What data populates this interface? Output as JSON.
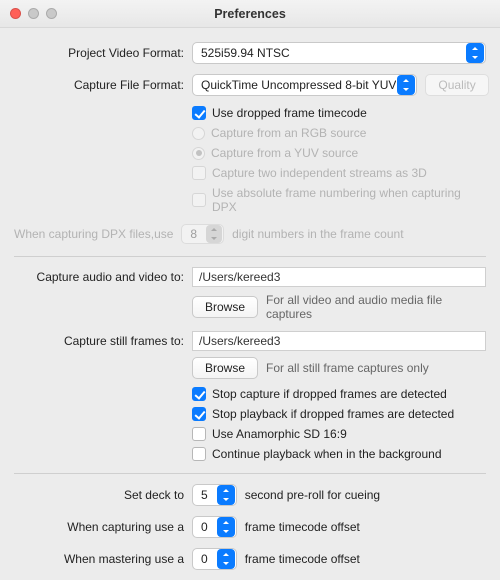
{
  "title": "Preferences",
  "format": {
    "video_label": "Project Video Format:",
    "video_value": "525i59.94 NTSC",
    "file_label": "Capture File Format:",
    "file_value": "QuickTime Uncompressed 8-bit YUV",
    "quality_btn": "Quality"
  },
  "timecode_opts": {
    "dropped_tc": "Use dropped frame timecode",
    "rgb_source": "Capture from an RGB source",
    "yuv_source": "Capture from a YUV source",
    "two_streams": "Capture two independent streams as 3D",
    "abs_frame": "Use absolute frame numbering when capturing DPX"
  },
  "dpx": {
    "prefix": "When capturing DPX files,use",
    "digits": "8",
    "suffix": "digit numbers in the frame count"
  },
  "paths": {
    "av_label": "Capture audio and video to:",
    "av_value": "/Users/kereed3",
    "av_hint": "For all video and audio media file captures",
    "still_label": "Capture still frames to:",
    "still_value": "/Users/kereed3",
    "still_hint": "For all still frame captures only",
    "browse": "Browse"
  },
  "capture_opts": {
    "stop_capture": "Stop capture if dropped frames are detected",
    "stop_playback": "Stop playback if dropped frames are detected",
    "anamorphic": "Use Anamorphic SD 16:9",
    "bg_playback": "Continue playback when in the background"
  },
  "deck": {
    "set_deck_label": "Set deck to",
    "set_deck_value": "5",
    "set_deck_suffix": "second pre-roll for cueing",
    "capture_label": "When capturing use a",
    "capture_value": "0",
    "capture_suffix": "frame timecode offset",
    "master_label": "When mastering use a",
    "master_value": "0",
    "master_suffix": "frame timecode offset"
  }
}
